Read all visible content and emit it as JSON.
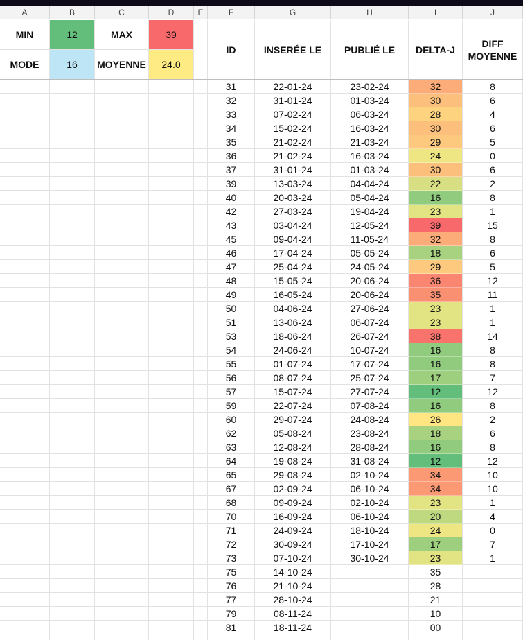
{
  "column_headers": [
    "A",
    "B",
    "C",
    "D",
    "E",
    "F",
    "G",
    "H",
    "I",
    "J"
  ],
  "summary": {
    "min_label": "MIN",
    "min_value": "12",
    "max_label": "MAX",
    "max_value": "39",
    "mode_label": "MODE",
    "mode_value": "16",
    "mean_label": "MOYENNE",
    "mean_value": "24.0"
  },
  "table_headers": {
    "id": "ID",
    "inserted": "INSERÉE LE",
    "published": "PUBLIÉ LE",
    "delta": "DELTA-J",
    "diff_line1": "DIFF",
    "diff_line2": "MOYENNE"
  },
  "colors": {
    "min": "#63be7b",
    "max": "#f8696b",
    "mode": "#bde5f6",
    "mean": "#ffeb84",
    "scale_low": "#63be7b",
    "scale_mid": "#ffeb84",
    "scale_high": "#f8696b"
  },
  "rows": [
    {
      "id": "31",
      "inserted": "22-01-24",
      "published": "23-02-24",
      "delta": "32",
      "diff": "8"
    },
    {
      "id": "32",
      "inserted": "31-01-24",
      "published": "01-03-24",
      "delta": "30",
      "diff": "6"
    },
    {
      "id": "33",
      "inserted": "07-02-24",
      "published": "06-03-24",
      "delta": "28",
      "diff": "4"
    },
    {
      "id": "34",
      "inserted": "15-02-24",
      "published": "16-03-24",
      "delta": "30",
      "diff": "6"
    },
    {
      "id": "35",
      "inserted": "21-02-24",
      "published": "21-03-24",
      "delta": "29",
      "diff": "5"
    },
    {
      "id": "36",
      "inserted": "21-02-24",
      "published": "16-03-24",
      "delta": "24",
      "diff": "0"
    },
    {
      "id": "37",
      "inserted": "31-01-24",
      "published": "01-03-24",
      "delta": "30",
      "diff": "6"
    },
    {
      "id": "39",
      "inserted": "13-03-24",
      "published": "04-04-24",
      "delta": "22",
      "diff": "2"
    },
    {
      "id": "40",
      "inserted": "20-03-24",
      "published": "05-04-24",
      "delta": "16",
      "diff": "8"
    },
    {
      "id": "42",
      "inserted": "27-03-24",
      "published": "19-04-24",
      "delta": "23",
      "diff": "1"
    },
    {
      "id": "43",
      "inserted": "03-04-24",
      "published": "12-05-24",
      "delta": "39",
      "diff": "15"
    },
    {
      "id": "45",
      "inserted": "09-04-24",
      "published": "11-05-24",
      "delta": "32",
      "diff": "8"
    },
    {
      "id": "46",
      "inserted": "17-04-24",
      "published": "05-05-24",
      "delta": "18",
      "diff": "6"
    },
    {
      "id": "47",
      "inserted": "25-04-24",
      "published": "24-05-24",
      "delta": "29",
      "diff": "5"
    },
    {
      "id": "48",
      "inserted": "15-05-24",
      "published": "20-06-24",
      "delta": "36",
      "diff": "12"
    },
    {
      "id": "49",
      "inserted": "16-05-24",
      "published": "20-06-24",
      "delta": "35",
      "diff": "11"
    },
    {
      "id": "50",
      "inserted": "04-06-24",
      "published": "27-06-24",
      "delta": "23",
      "diff": "1"
    },
    {
      "id": "51",
      "inserted": "13-06-24",
      "published": "06-07-24",
      "delta": "23",
      "diff": "1"
    },
    {
      "id": "53",
      "inserted": "18-06-24",
      "published": "26-07-24",
      "delta": "38",
      "diff": "14"
    },
    {
      "id": "54",
      "inserted": "24-06-24",
      "published": "10-07-24",
      "delta": "16",
      "diff": "8"
    },
    {
      "id": "55",
      "inserted": "01-07-24",
      "published": "17-07-24",
      "delta": "16",
      "diff": "8"
    },
    {
      "id": "56",
      "inserted": "08-07-24",
      "published": "25-07-24",
      "delta": "17",
      "diff": "7"
    },
    {
      "id": "57",
      "inserted": "15-07-24",
      "published": "27-07-24",
      "delta": "12",
      "diff": "12"
    },
    {
      "id": "59",
      "inserted": "22-07-24",
      "published": "07-08-24",
      "delta": "16",
      "diff": "8"
    },
    {
      "id": "60",
      "inserted": "29-07-24",
      "published": "24-08-24",
      "delta": "26",
      "diff": "2"
    },
    {
      "id": "62",
      "inserted": "05-08-24",
      "published": "23-08-24",
      "delta": "18",
      "diff": "6"
    },
    {
      "id": "63",
      "inserted": "12-08-24",
      "published": "28-08-24",
      "delta": "16",
      "diff": "8"
    },
    {
      "id": "64",
      "inserted": "19-08-24",
      "published": "31-08-24",
      "delta": "12",
      "diff": "12"
    },
    {
      "id": "65",
      "inserted": "29-08-24",
      "published": "02-10-24",
      "delta": "34",
      "diff": "10"
    },
    {
      "id": "67",
      "inserted": "02-09-24",
      "published": "06-10-24",
      "delta": "34",
      "diff": "10"
    },
    {
      "id": "68",
      "inserted": "09-09-24",
      "published": "02-10-24",
      "delta": "23",
      "diff": "1"
    },
    {
      "id": "70",
      "inserted": "16-09-24",
      "published": "06-10-24",
      "delta": "20",
      "diff": "4"
    },
    {
      "id": "71",
      "inserted": "24-09-24",
      "published": "18-10-24",
      "delta": "24",
      "diff": "0"
    },
    {
      "id": "72",
      "inserted": "30-09-24",
      "published": "17-10-24",
      "delta": "17",
      "diff": "7"
    },
    {
      "id": "73",
      "inserted": "07-10-24",
      "published": "30-10-24",
      "delta": "23",
      "diff": "1"
    },
    {
      "id": "75",
      "inserted": "14-10-24",
      "published": "",
      "delta": "35",
      "diff": ""
    },
    {
      "id": "76",
      "inserted": "21-10-24",
      "published": "",
      "delta": "28",
      "diff": ""
    },
    {
      "id": "77",
      "inserted": "28-10-24",
      "published": "",
      "delta": "21",
      "diff": ""
    },
    {
      "id": "79",
      "inserted": "08-11-24",
      "published": "",
      "delta": "10",
      "diff": ""
    },
    {
      "id": "81",
      "inserted": "18-11-24",
      "published": "",
      "delta": "00",
      "diff": ""
    }
  ]
}
